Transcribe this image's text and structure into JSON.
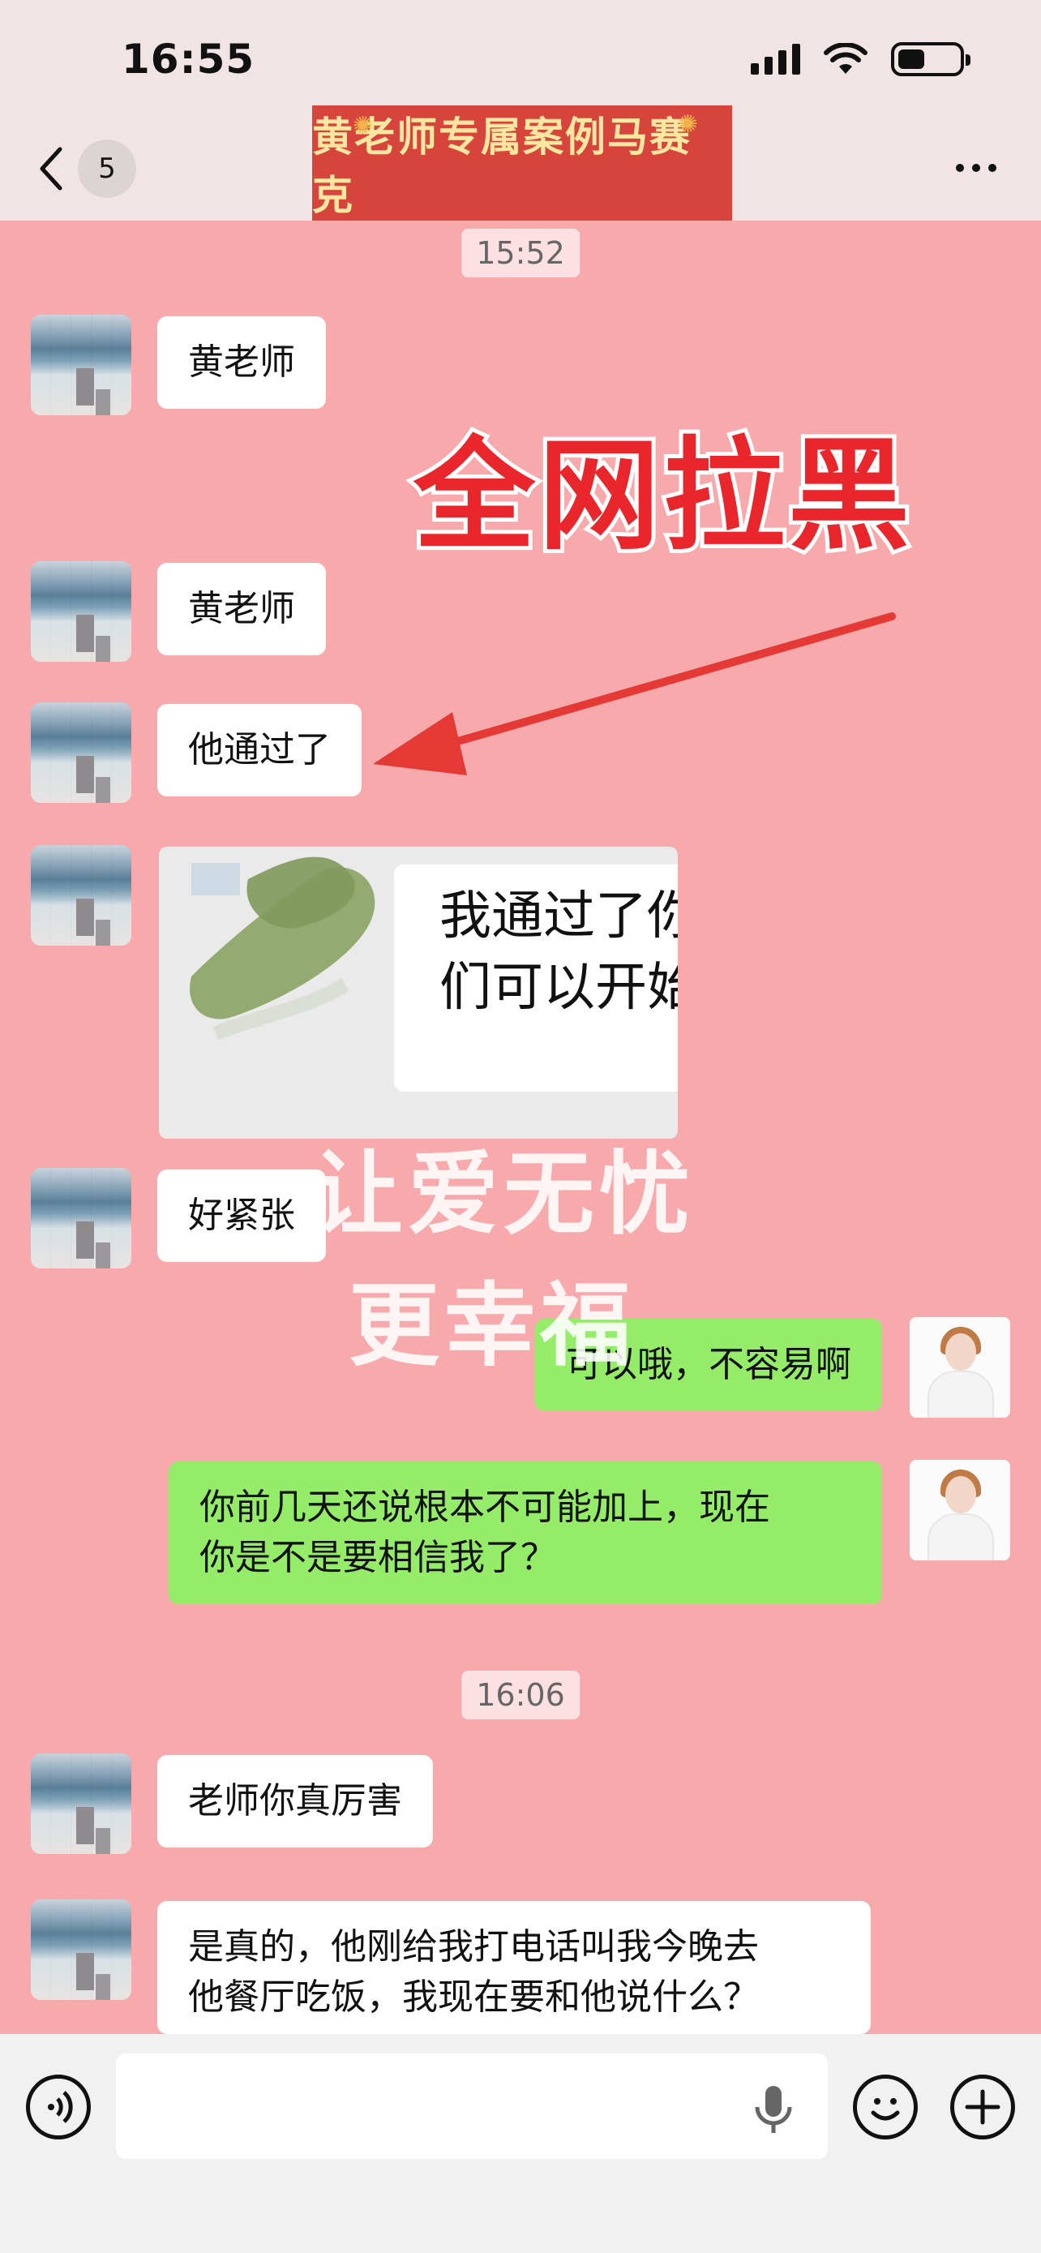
{
  "status_bar": {
    "time": "16:55",
    "battery_level": 0.44
  },
  "header": {
    "unread_count": "5",
    "title": "黄老师专属案例马赛克"
  },
  "annotation": {
    "headline": "全网拉黑",
    "arrow_color": "#e53935",
    "watermark_line1": "让爱无忧",
    "watermark_line2": "更幸福"
  },
  "messages": [
    {
      "type": "timestamp",
      "text": "15:52"
    },
    {
      "type": "in",
      "text": "黄老师"
    },
    {
      "type": "in",
      "text": "黄老师"
    },
    {
      "type": "in",
      "text": "他通过了"
    },
    {
      "type": "in_image",
      "lines": [
        "我通过了你",
        "们可以开始"
      ]
    },
    {
      "type": "in",
      "text": "好紧张"
    },
    {
      "type": "out",
      "text": "可以哦，不容易啊"
    },
    {
      "type": "out",
      "lines": [
        "你前几天还说根本不可能加上，现在",
        "你是不是要相信我了？"
      ]
    },
    {
      "type": "timestamp",
      "text": "16:06"
    },
    {
      "type": "in",
      "text": "老师你真厉害"
    },
    {
      "type": "in",
      "lines": [
        "是真的，他刚给我打电话叫我今晚去",
        "他餐厅吃饭，我现在要和他说什么？"
      ]
    }
  ],
  "colors": {
    "chat_background": "#f8a9ac",
    "incoming_bubble": "#ffffff",
    "outgoing_bubble": "#95ec69",
    "header_background": "#f1e4e5",
    "banner_background": "#d6443b",
    "banner_text": "#fbe7a0"
  },
  "icons": {
    "back": "chevron-left-icon",
    "more": "more-dots-icon",
    "voice": "voice-icon",
    "mic": "microphone-icon",
    "emoji": "emoji-icon",
    "plus": "plus-icon"
  }
}
